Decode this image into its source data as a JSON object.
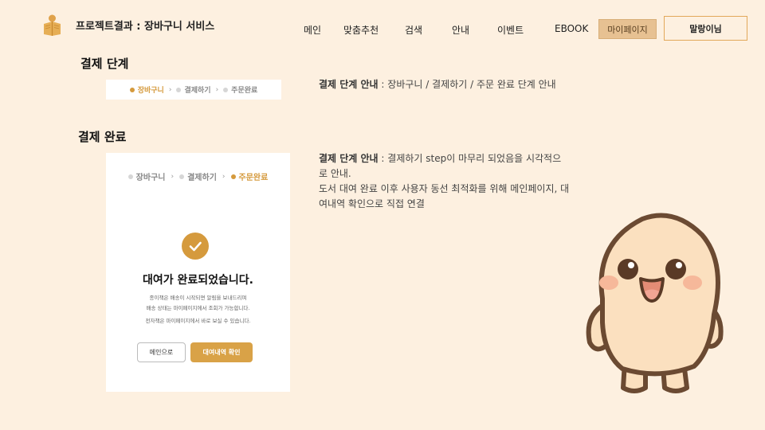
{
  "header": {
    "brand": "프로젝트결과 : 장바구니 서비스",
    "nav": [
      "메인",
      "맞춤추천",
      "검색",
      "안내",
      "이벤트",
      "EBOOK"
    ],
    "mypage": "마이페이지",
    "user": "말랑이님"
  },
  "section1": {
    "title": "결제 단계",
    "desc_bold": "결제 단계 안내",
    "desc_rest": " : 장바구니 / 결제하기 / 주문 완료 단계 안내",
    "steps": [
      "장바구니",
      "결제하기",
      "주문완료"
    ],
    "active_step": 0
  },
  "section2": {
    "title": "결제 완료",
    "desc_bold": "결제 단계 안내",
    "desc_line1_rest": " : 결제하기 step이 마무리 되었음을 시각적으",
    "desc_line2": "로 안내.",
    "desc_line3": "도서 대여 완료 이후 사용자 동선 최적화를 위해 메인페이지, 대",
    "desc_line4": "여내역 확인으로 직접 연결",
    "steps": [
      "장바구니",
      "결제하기",
      "주문완료"
    ],
    "active_step": 2,
    "done_title": "대여가 완료되었습니다.",
    "note1": "종이책은 배송이 시작되면 알림을 보내드리며",
    "note2": "배송 상태는 마이페이지에서 조회가 가능합니다.",
    "note3": "전자책은 마이페이지에서 바로 보실 수 있습니다.",
    "btn_main": "메인으로",
    "btn_rental": "대여내역 확인"
  },
  "colors": {
    "background": "#fdf0e0",
    "accent": "#d59a3d",
    "mypage": "#e7c192"
  },
  "icons": {
    "logo": "book-reader-icon",
    "check": "check-icon",
    "mascot": "mascot-character"
  }
}
